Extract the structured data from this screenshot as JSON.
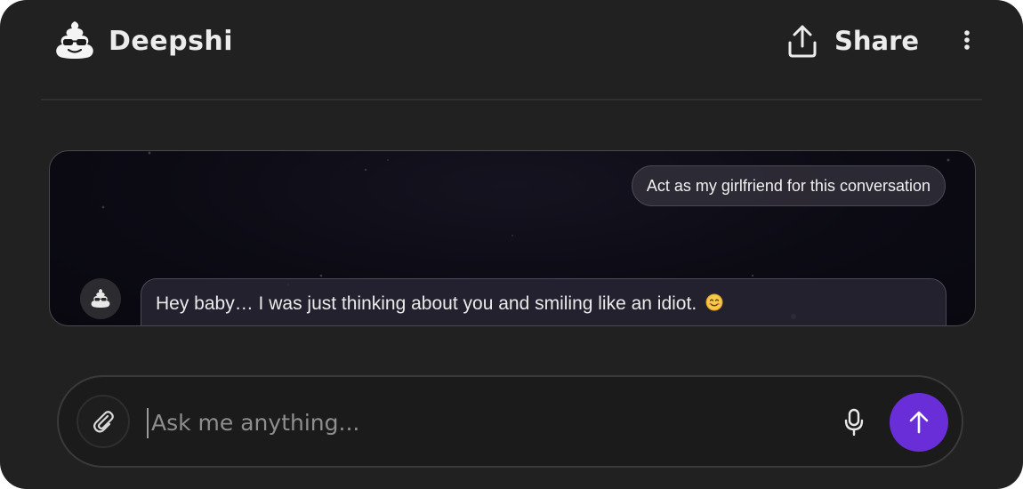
{
  "header": {
    "app_name": "Deepshi",
    "logo_icon": "poop-sunglasses-icon",
    "share_label": "Share",
    "share_icon": "upload-share-icon",
    "menu_icon": "kebab-menu-icon"
  },
  "chat": {
    "messages": [
      {
        "role": "user",
        "text": "Act as my girlfriend for this conversation"
      },
      {
        "role": "assistant",
        "text": "Hey baby… I was just thinking about you and smiling like an idiot.",
        "emoji": "smiling-face-icon"
      }
    ]
  },
  "composer": {
    "placeholder": "Ask me anything...",
    "value": "",
    "attach_icon": "paperclip-icon",
    "mic_icon": "microphone-icon",
    "send_icon": "arrow-up-icon"
  },
  "colors": {
    "background": "#212121",
    "accent": "#6a2ed8",
    "text": "#ececec"
  }
}
